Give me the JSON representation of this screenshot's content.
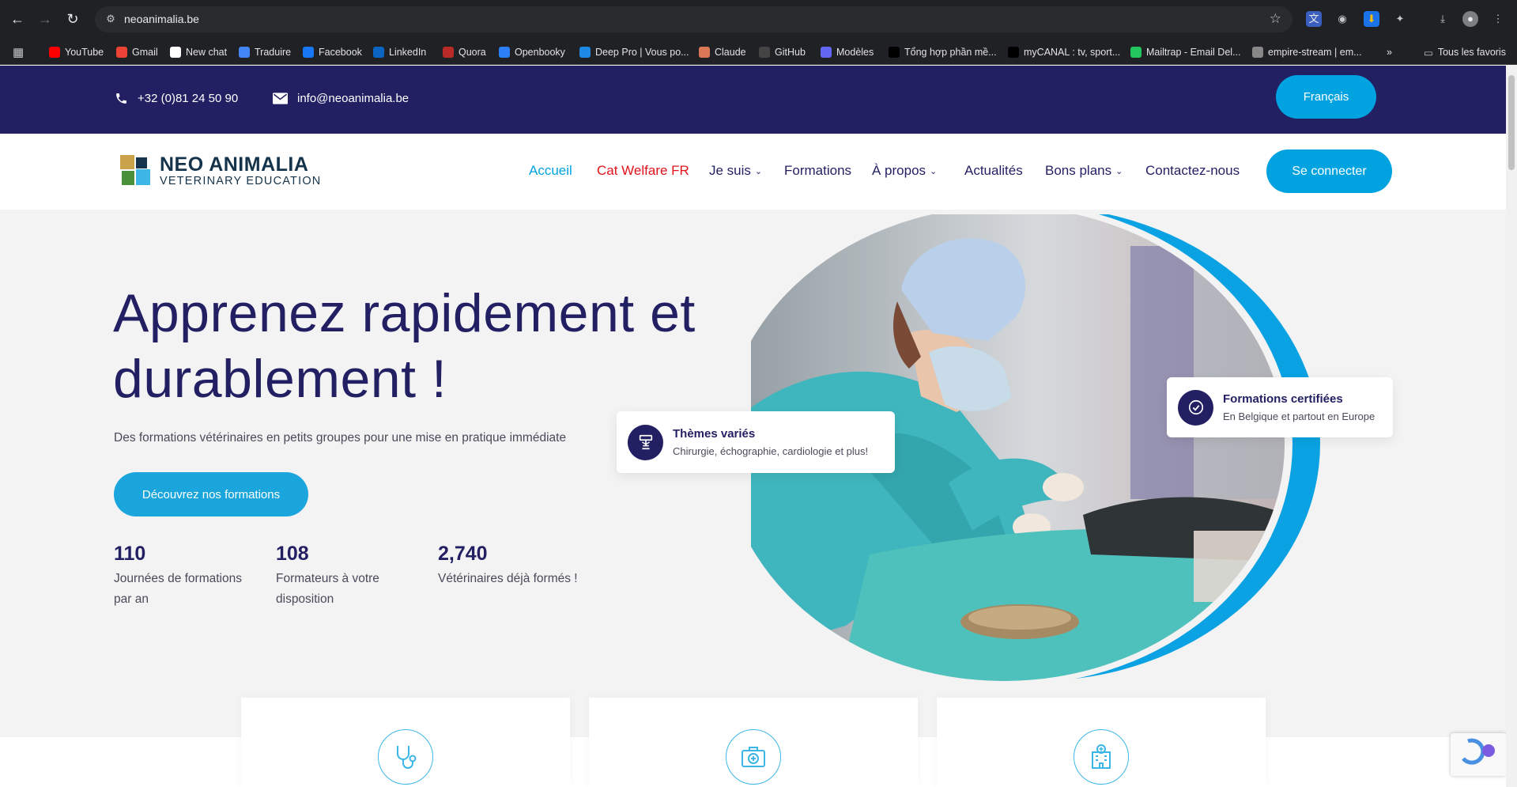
{
  "browser": {
    "url": "neoanimalia.be",
    "bookmarks": [
      {
        "label": "YouTube",
        "color": "#ff0000",
        "icon": "youtube-icon"
      },
      {
        "label": "Gmail",
        "color": "#ea4335",
        "icon": "gmail-icon"
      },
      {
        "label": "New chat",
        "color": "#ffffff",
        "icon": "chatgpt-icon"
      },
      {
        "label": "Traduire",
        "color": "#4285f4",
        "icon": "translate-icon"
      },
      {
        "label": "Facebook",
        "color": "#1877f2",
        "icon": "facebook-icon"
      },
      {
        "label": "LinkedIn",
        "color": "#0a66c2",
        "icon": "linkedin-icon"
      },
      {
        "label": "Quora",
        "color": "#b92b27",
        "icon": "quora-icon"
      },
      {
        "label": "Openbooky",
        "color": "#2d7ff9",
        "icon": "book-icon"
      },
      {
        "label": "Deep Pro | Vous po...",
        "color": "#1e88e5",
        "icon": "deep-icon"
      },
      {
        "label": "Claude",
        "color": "#d97757",
        "icon": "claude-icon"
      },
      {
        "label": "GitHub",
        "color": "#444444",
        "icon": "github-icon"
      },
      {
        "label": "Modèles",
        "color": "#6366f1",
        "icon": "template-icon"
      },
      {
        "label": "Tổng hợp phần mề...",
        "color": "#000000",
        "icon": "t-icon"
      },
      {
        "label": "myCANAL : tv, sport...",
        "color": "#000000",
        "icon": "canal-icon"
      },
      {
        "label": "Mailtrap - Email Del...",
        "color": "#22c55e",
        "icon": "mail-icon"
      },
      {
        "label": "empire-stream | em...",
        "color": "#888888",
        "icon": "globe-icon"
      }
    ],
    "all_bookmarks_label": "Tous les favoris",
    "overflow_label": "»"
  },
  "topbar": {
    "phone": "+32 (0)81 24 50 90",
    "email": "info@neoanimalia.be",
    "language_label": "Français"
  },
  "brand": {
    "name": "NEO ANIMALIA",
    "tagline": "VETERINARY EDUCATION",
    "colors": {
      "navy": "#221f63",
      "blue": "#00a3e0",
      "red": "#e0131a"
    }
  },
  "nav": {
    "items": [
      {
        "label": "Accueil",
        "state": "active"
      },
      {
        "label": "Cat Welfare FR",
        "state": "highlight"
      },
      {
        "label": "Je suis",
        "dropdown": true
      },
      {
        "label": "Formations"
      },
      {
        "label": "À propos",
        "dropdown": true
      },
      {
        "label": "Actualités"
      },
      {
        "label": "Bons plans",
        "dropdown": true
      },
      {
        "label": "Contactez-nous"
      }
    ],
    "login_label": "Se connecter"
  },
  "hero": {
    "title": "Apprenez rapidement et durablement !",
    "subtitle": "Des formations vétérinaires en petits groupes pour une mise en pratique immédiate",
    "cta_label": "Découvrez nos formations",
    "stats": [
      {
        "value": "110",
        "label": "Journées de formations par an"
      },
      {
        "value": "108",
        "label": "Formateurs à votre disposition"
      },
      {
        "value": "2,740",
        "label": "Vétérinaires déjà formés !"
      }
    ],
    "badges": [
      {
        "title": "Thèmes variés",
        "text": "Chirurgie, échographie, cardiologie et plus!",
        "icon": "lectern-icon"
      },
      {
        "title": "Formations certifiées",
        "text": "En Belgique et partout en Europe",
        "icon": "check-circle-icon"
      }
    ]
  },
  "cards": [
    {
      "icon": "stethoscope-icon"
    },
    {
      "icon": "medical-kit-icon"
    },
    {
      "icon": "hospital-icon"
    }
  ]
}
